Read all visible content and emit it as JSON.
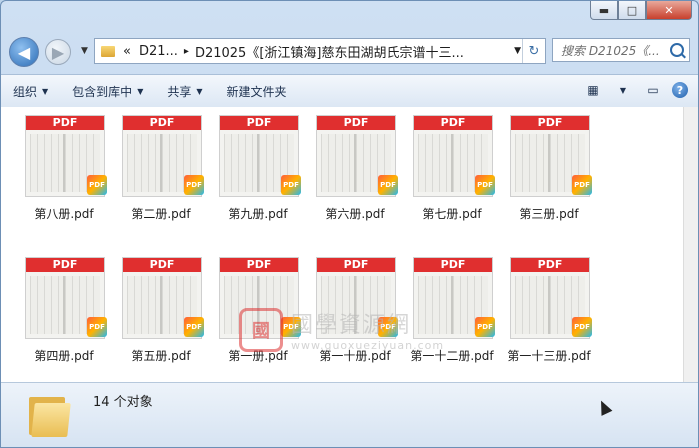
{
  "window_controls": {
    "minimize": "▬",
    "maximize": "□",
    "close": "✕"
  },
  "nav": {
    "back_glyph": "◀",
    "forward_glyph": "▶",
    "history_glyph": "▼"
  },
  "address": {
    "collapse": "«",
    "crumbs": [
      "D21...",
      "D21025《[浙江镇海]慈东田湖胡氏宗谱十三..."
    ],
    "separator": "▸",
    "dropdown": "▼",
    "refresh_glyph": "↻"
  },
  "search": {
    "placeholder": "搜索 D21025《..."
  },
  "toolbar": {
    "organize": "组织",
    "include_library": "包含到库中",
    "share": "共享",
    "new_folder": "新建文件夹",
    "dropdown_arrow": "▼",
    "view_glyph": "▦",
    "pane_glyph": "▭",
    "help_glyph": "?"
  },
  "thumb_band": "PDF",
  "badge_text": "PDF",
  "files": [
    {
      "name": "第八册.pdf"
    },
    {
      "name": "第二册.pdf"
    },
    {
      "name": "第九册.pdf"
    },
    {
      "name": "第六册.pdf"
    },
    {
      "name": "第七册.pdf"
    },
    {
      "name": "第三册.pdf"
    },
    {
      "name": "第四册.pdf"
    },
    {
      "name": "第五册.pdf"
    },
    {
      "name": "第一册.pdf"
    },
    {
      "name": "第一十册.pdf"
    },
    {
      "name": "第一十二册.pdf"
    },
    {
      "name": "第一十三册.pdf"
    }
  ],
  "watermark": {
    "logo": "國",
    "name": "國學資源網",
    "url": "www.guoxueziyuan.com"
  },
  "status": {
    "count": "14 个对象"
  },
  "colors": {
    "accent": "#e02f2f",
    "window_frame": "#b9d0ea"
  }
}
